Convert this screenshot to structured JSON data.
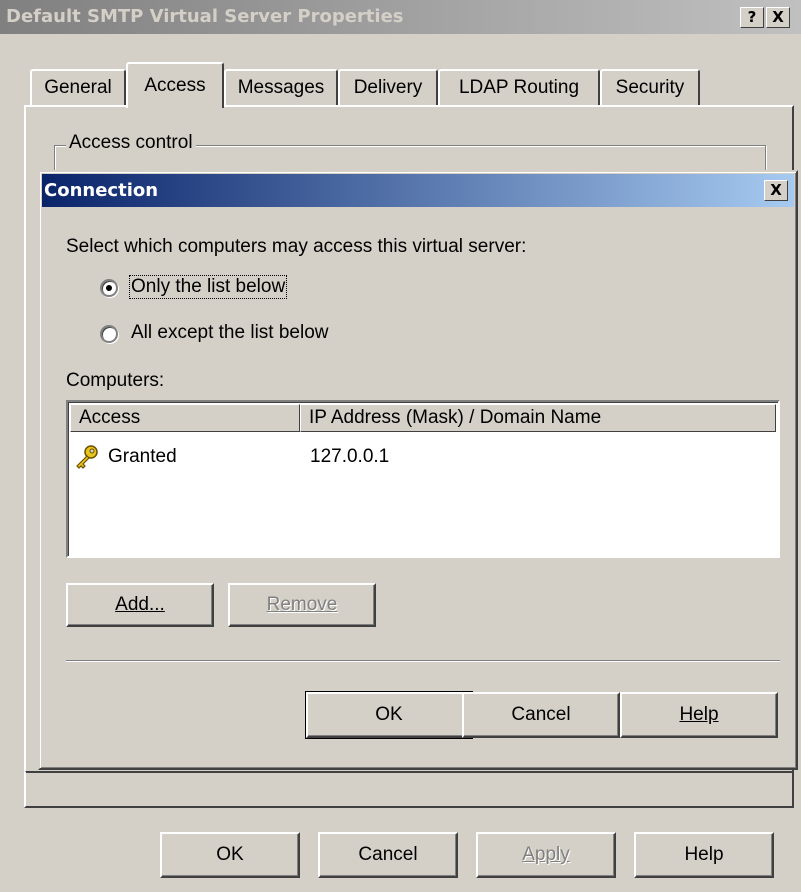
{
  "outer_dialog": {
    "title": "Default SMTP Virtual Server Properties",
    "help_glyph": "?",
    "close_glyph": "X",
    "tabs": [
      {
        "label": "General"
      },
      {
        "label": "Access"
      },
      {
        "label": "Messages"
      },
      {
        "label": "Delivery"
      },
      {
        "label": "LDAP Routing"
      },
      {
        "label": "Security"
      }
    ],
    "active_tab": "Access",
    "group_label": "Access control",
    "buttons": {
      "ok": "OK",
      "cancel": "Cancel",
      "apply": "Apply",
      "help": "Help"
    }
  },
  "connection_dialog": {
    "title": "Connection",
    "close_glyph": "X",
    "prompt": "Select which computers may access this virtual server:",
    "radio_options": [
      {
        "label": "Only the list below",
        "selected": true
      },
      {
        "label": "All except the list below",
        "selected": false
      }
    ],
    "computers_label": "Computers:",
    "columns": [
      "Access",
      "IP Address (Mask) / Domain Name"
    ],
    "rows": [
      {
        "access": "Granted",
        "address": "127.0.0.1",
        "icon": "key-icon"
      }
    ],
    "add_button": "Add...",
    "remove_button": "Remove",
    "ok_button": "OK",
    "cancel_button": "Cancel",
    "help_button": "Help"
  }
}
